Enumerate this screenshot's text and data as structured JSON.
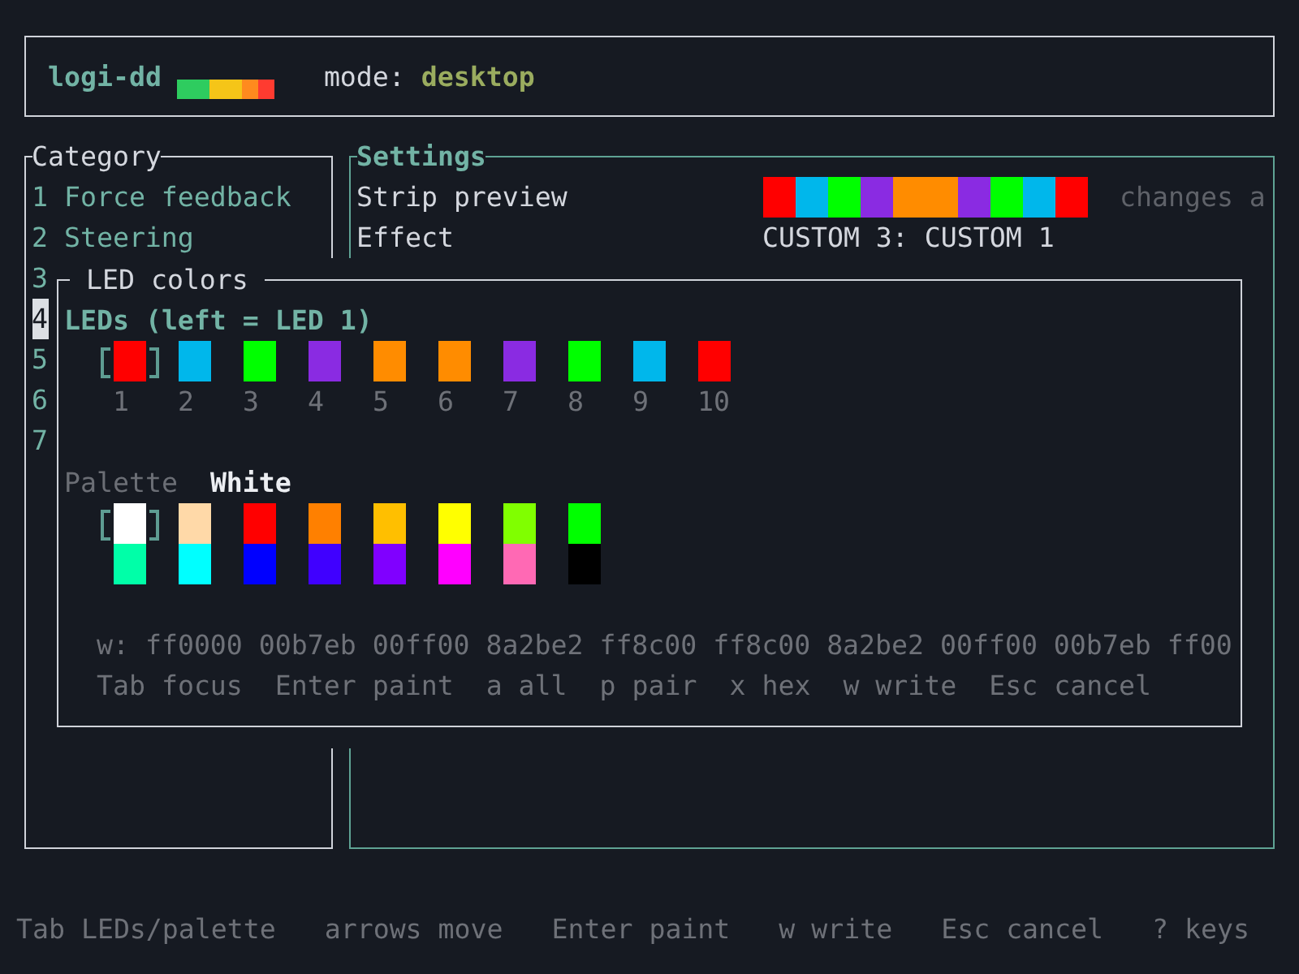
{
  "header": {
    "app_name": "logi-dd",
    "mode_label": "mode:",
    "mode_value": "desktop"
  },
  "category": {
    "title": "Category",
    "items": [
      {
        "label": "1 Force feedback",
        "selected": false
      },
      {
        "label": "2 Steering",
        "selected": false
      },
      {
        "label": "3",
        "selected": false
      },
      {
        "label": "4",
        "selected": true
      },
      {
        "label": "5",
        "selected": false
      },
      {
        "label": "6",
        "selected": false
      },
      {
        "label": "7",
        "selected": false
      }
    ]
  },
  "settings": {
    "title": "Settings",
    "rows": [
      {
        "kind": "strip",
        "label": "Strip preview",
        "segments": [
          {
            "color": "#ff0000"
          },
          {
            "color": "#00b7eb"
          },
          {
            "color": "#00ff00"
          },
          {
            "color": "#8a2be2"
          },
          {
            "color": "#ff8c00"
          },
          {
            "color": "#ff8c00"
          },
          {
            "color": "#8a2be2"
          },
          {
            "color": "#00ff00"
          },
          {
            "color": "#00b7eb"
          },
          {
            "color": "#ff0000"
          }
        ],
        "note": "changes a"
      },
      {
        "kind": "text",
        "label": "Effect",
        "value": "CUSTOM 3: CUSTOM 1"
      }
    ]
  },
  "led_dialog": {
    "title": "LED colors",
    "leds_heading": "LEDs (left = LED 1)",
    "leds": [
      {
        "number": "1",
        "color": "#ff0000",
        "selected": true
      },
      {
        "number": "2",
        "color": "#00b7eb",
        "selected": false
      },
      {
        "number": "3",
        "color": "#00ff00",
        "selected": false
      },
      {
        "number": "4",
        "color": "#8a2be2",
        "selected": false
      },
      {
        "number": "5",
        "color": "#ff8c00",
        "selected": false
      },
      {
        "number": "6",
        "color": "#ff8c00",
        "selected": false
      },
      {
        "number": "7",
        "color": "#8a2be2",
        "selected": false
      },
      {
        "number": "8",
        "color": "#00ff00",
        "selected": false
      },
      {
        "number": "9",
        "color": "#00b7eb",
        "selected": false
      },
      {
        "number": "10",
        "color": "#ff0000",
        "selected": false
      }
    ],
    "palette_label": "Palette",
    "palette_current": "White",
    "palette": [
      {
        "color": "#ffffff",
        "selected": true
      },
      {
        "color": "#ffd9a8",
        "selected": false
      },
      {
        "color": "#ff0000",
        "selected": false
      },
      {
        "color": "#ff8000",
        "selected": false
      },
      {
        "color": "#ffbf00",
        "selected": false
      },
      {
        "color": "#ffff00",
        "selected": false
      },
      {
        "color": "#80ff00",
        "selected": false
      },
      {
        "color": "#00ff00",
        "selected": false
      },
      {
        "color": "#00ffa8",
        "selected": false
      },
      {
        "color": "#00ffff",
        "selected": false
      },
      {
        "color": "#0000ff",
        "selected": false
      },
      {
        "color": "#4000ff",
        "selected": false
      },
      {
        "color": "#8000ff",
        "selected": false
      },
      {
        "color": "#ff00ff",
        "selected": false
      },
      {
        "color": "#ff69b4",
        "selected": false
      },
      {
        "color": "#000000",
        "selected": false
      }
    ],
    "hex_line": "w: ff0000 00b7eb 00ff00 8a2be2 ff8c00 ff8c00 8a2be2 00ff00 00b7eb ff00",
    "hints": [
      "Tab focus",
      "Enter paint",
      "a all",
      "p pair",
      "x hex",
      "w write",
      "Esc cancel"
    ]
  },
  "footer": {
    "hints": [
      "Tab LEDs/palette",
      "arrows move",
      "Enter paint",
      "w write",
      "Esc cancel",
      "? keys"
    ]
  }
}
